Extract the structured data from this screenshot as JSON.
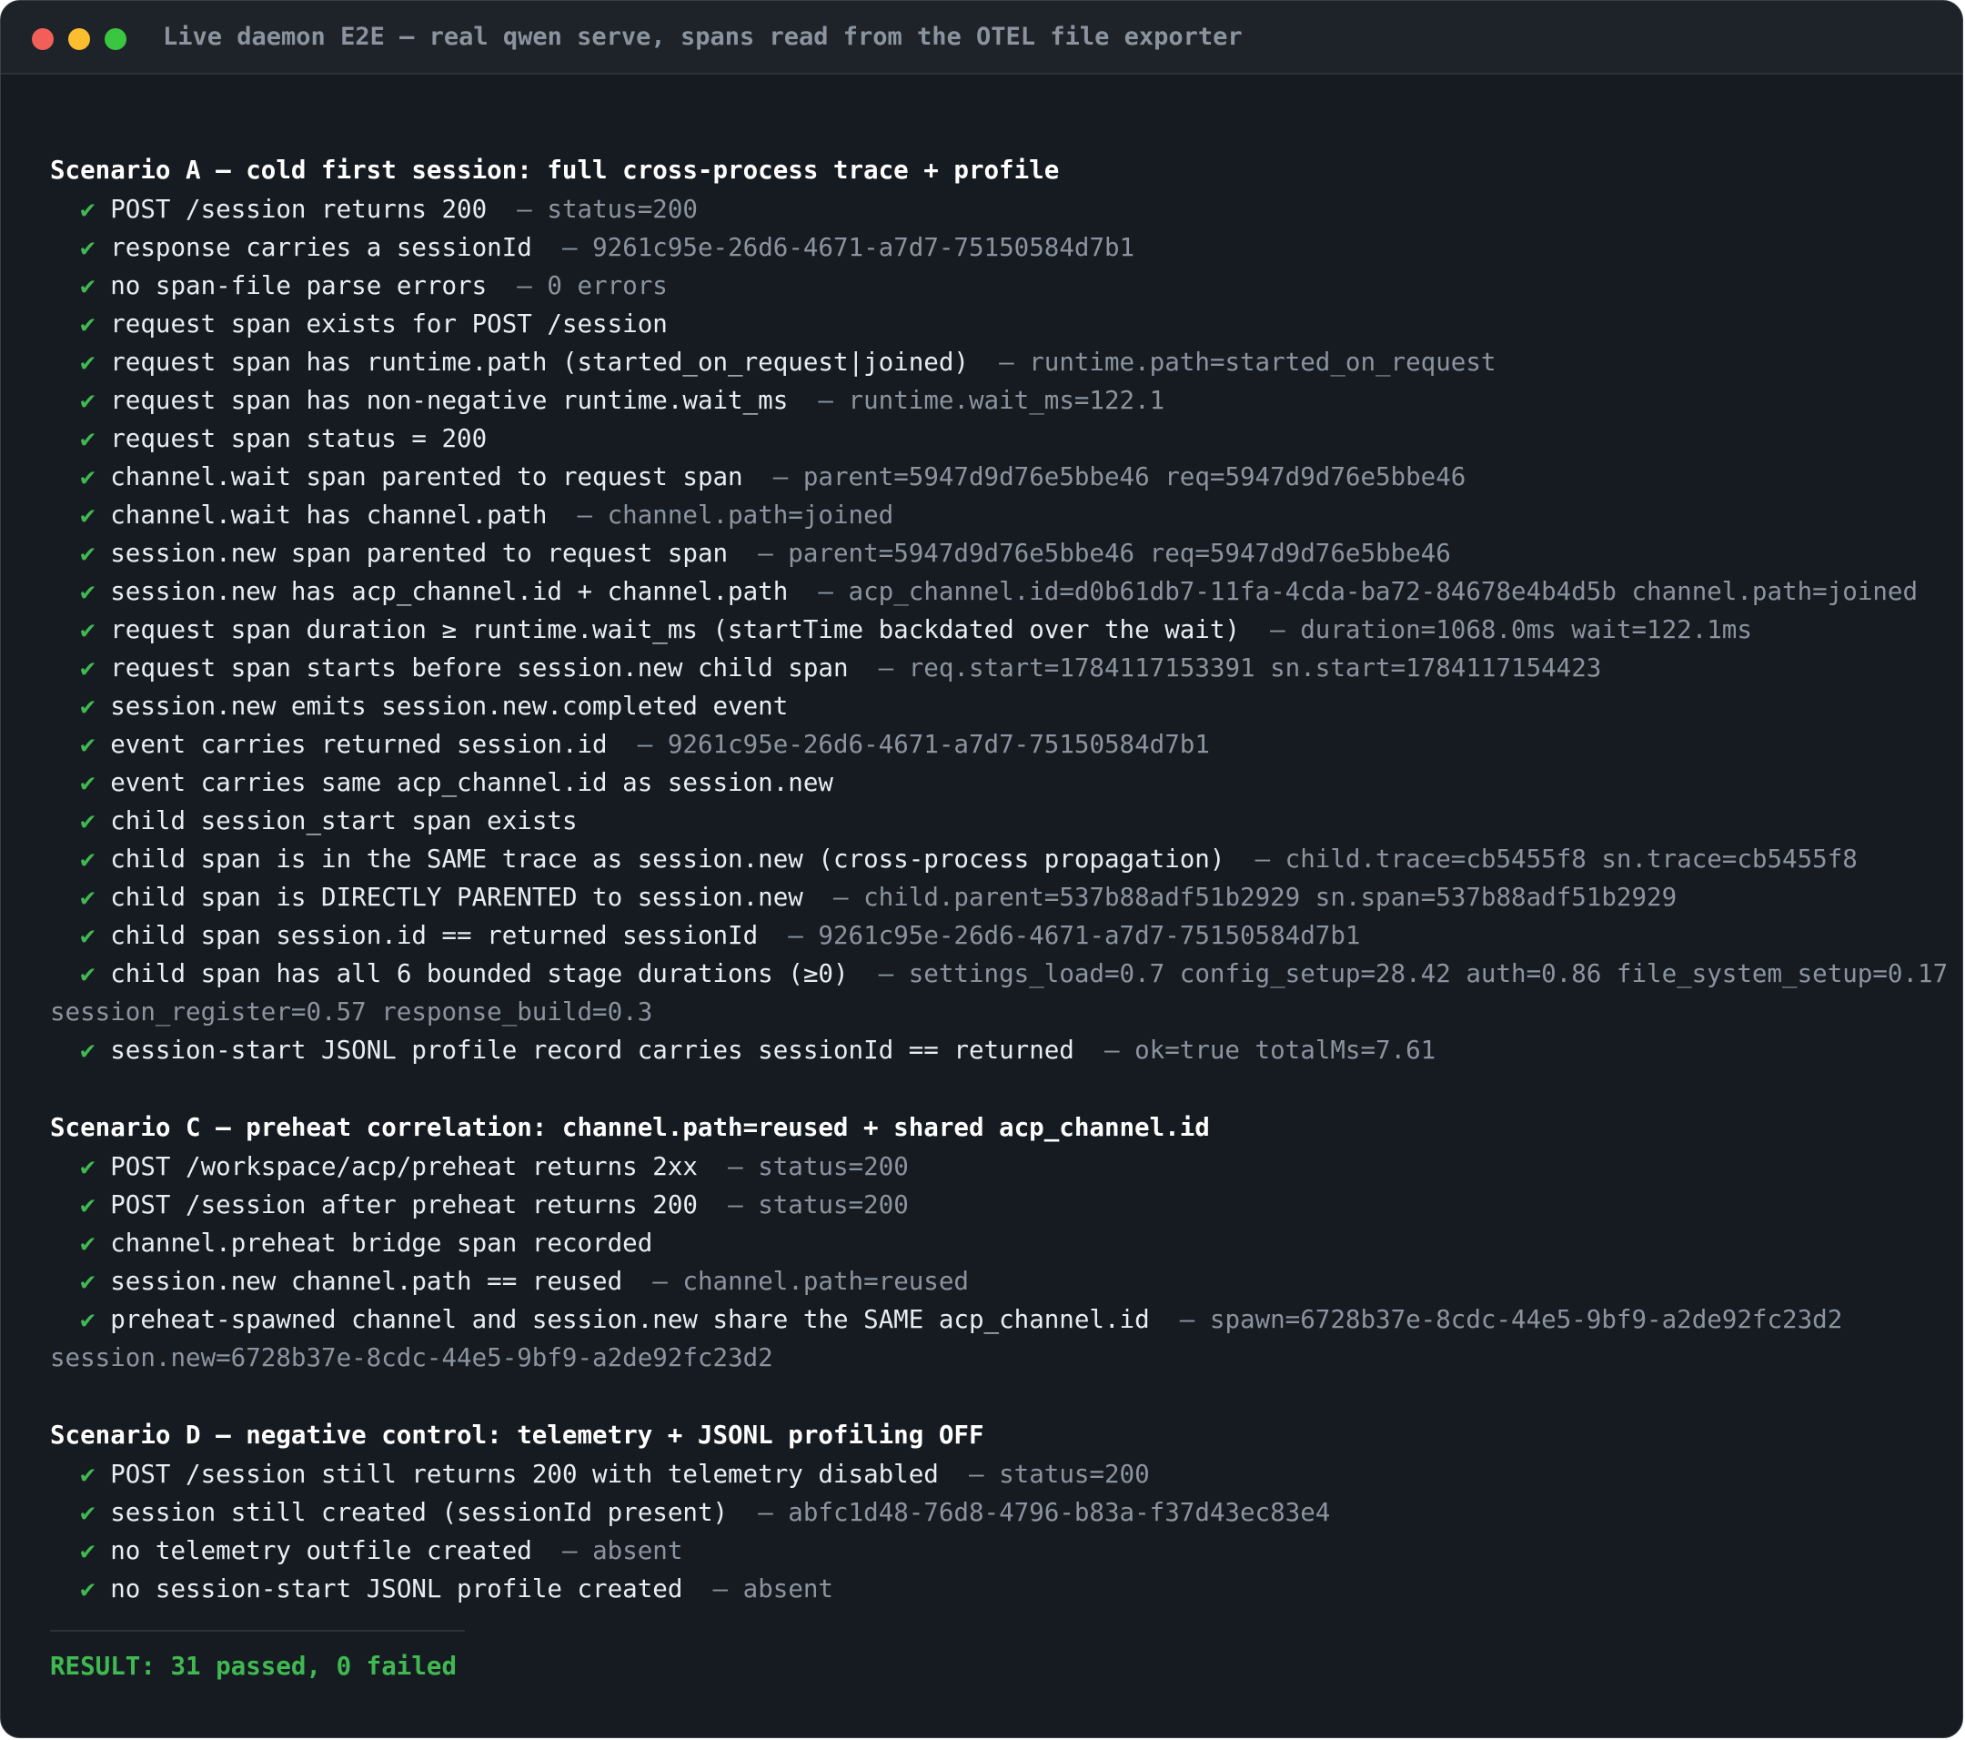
{
  "window": {
    "title": "Live daemon E2E — real qwen serve, spans read from the OTEL file exporter",
    "controls": [
      "close",
      "minimize",
      "maximize"
    ]
  },
  "check_mark": "✔",
  "scenarios": [
    {
      "title": "Scenario A — cold first session: full cross-process trace + profile",
      "checks": [
        {
          "text": "POST /session returns 200",
          "detail": "— status=200"
        },
        {
          "text": "response carries a sessionId",
          "detail": "— 9261c95e-26d6-4671-a7d7-75150584d7b1"
        },
        {
          "text": "no span-file parse errors",
          "detail": "— 0 errors"
        },
        {
          "text": "request span exists for POST /session",
          "detail": ""
        },
        {
          "text": "request span has runtime.path (started_on_request|joined)",
          "detail": "— runtime.path=started_on_request"
        },
        {
          "text": "request span has non-negative runtime.wait_ms",
          "detail": "— runtime.wait_ms=122.1"
        },
        {
          "text": "request span status = 200",
          "detail": ""
        },
        {
          "text": "channel.wait span parented to request span",
          "detail": "— parent=5947d9d76e5bbe46 req=5947d9d76e5bbe46"
        },
        {
          "text": "channel.wait has channel.path",
          "detail": "— channel.path=joined"
        },
        {
          "text": "session.new span parented to request span",
          "detail": "— parent=5947d9d76e5bbe46 req=5947d9d76e5bbe46"
        },
        {
          "text": "session.new has acp_channel.id + channel.path",
          "detail": "— acp_channel.id=d0b61db7-11fa-4cda-ba72-84678e4b4d5b channel.path=joined"
        },
        {
          "text": "request span duration ≥ runtime.wait_ms (startTime backdated over the wait)",
          "detail": "— duration=1068.0ms wait=122.1ms"
        },
        {
          "text": "request span starts before session.new child span",
          "detail": "— req.start=1784117153391 sn.start=1784117154423"
        },
        {
          "text": "session.new emits session.new.completed event",
          "detail": ""
        },
        {
          "text": "event carries returned session.id",
          "detail": "— 9261c95e-26d6-4671-a7d7-75150584d7b1"
        },
        {
          "text": "event carries same acp_channel.id as session.new",
          "detail": ""
        },
        {
          "text": "child session_start span exists",
          "detail": ""
        },
        {
          "text": "child span is in the SAME trace as session.new (cross-process propagation)",
          "detail": "— child.trace=cb5455f8 sn.trace=cb5455f8"
        },
        {
          "text": "child span is DIRECTLY PARENTED to session.new",
          "detail": "— child.parent=537b88adf51b2929 sn.span=537b88adf51b2929"
        },
        {
          "text": "child span session.id == returned sessionId",
          "detail": "— 9261c95e-26d6-4671-a7d7-75150584d7b1"
        },
        {
          "text": "child span has all 6 bounded stage durations (≥0)",
          "detail": "— settings_load=0.7 config_setup=28.42 auth=0.86 file_system_setup=0.17",
          "continuation": "session_register=0.57 response_build=0.3"
        },
        {
          "text": "session-start JSONL profile record carries sessionId == returned",
          "detail": "— ok=true totalMs=7.61"
        }
      ]
    },
    {
      "title": "Scenario C — preheat correlation: channel.path=reused + shared acp_channel.id",
      "checks": [
        {
          "text": "POST /workspace/acp/preheat returns 2xx",
          "detail": "— status=200"
        },
        {
          "text": "POST /session after preheat returns 200",
          "detail": "— status=200"
        },
        {
          "text": "channel.preheat bridge span recorded",
          "detail": ""
        },
        {
          "text": "session.new channel.path == reused",
          "detail": "— channel.path=reused"
        },
        {
          "text": "preheat-spawned channel and session.new share the SAME acp_channel.id",
          "detail": "— spawn=6728b37e-8cdc-44e5-9bf9-a2de92fc23d2",
          "continuation": "session.new=6728b37e-8cdc-44e5-9bf9-a2de92fc23d2"
        }
      ]
    },
    {
      "title": "Scenario D — negative control: telemetry + JSONL profiling OFF",
      "checks": [
        {
          "text": "POST /session still returns 200 with telemetry disabled",
          "detail": "— status=200"
        },
        {
          "text": "session still created (sessionId present)",
          "detail": "— abfc1d48-76d8-4796-b83a-f37d43ec83e4"
        },
        {
          "text": "no telemetry outfile created",
          "detail": "— absent"
        },
        {
          "text": "no session-start JSONL profile created",
          "detail": "— absent"
        }
      ]
    }
  ],
  "result": "RESULT: 31 passed, 0 failed",
  "colors": {
    "background": "#161b22",
    "titlebar": "#1e2329",
    "pass": "#3fb950",
    "detail": "#8b949e",
    "text": "#e6edf3"
  }
}
